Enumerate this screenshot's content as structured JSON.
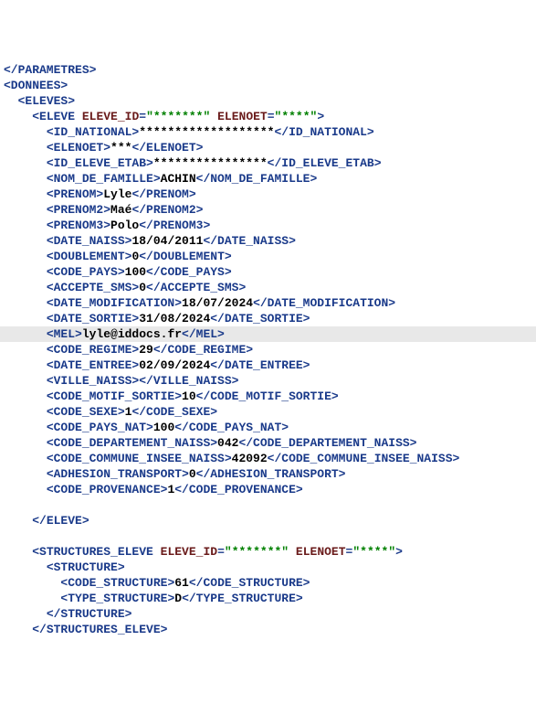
{
  "lines": [
    {
      "indent": 0,
      "type": "close",
      "tag": "PARAMETRES"
    },
    {
      "indent": 0,
      "type": "open",
      "tag": "DONNEES"
    },
    {
      "indent": 1,
      "type": "open",
      "tag": "ELEVES"
    },
    {
      "indent": 2,
      "type": "open-attrs",
      "tag": "ELEVE",
      "attrs": [
        {
          "name": "ELEVE_ID",
          "val": "*******"
        },
        {
          "name": "ELENOET",
          "val": "****"
        }
      ]
    },
    {
      "indent": 3,
      "type": "leaf",
      "tag": "ID_NATIONAL",
      "val": "*******************"
    },
    {
      "indent": 3,
      "type": "leaf",
      "tag": "ELENOET",
      "val": "***"
    },
    {
      "indent": 3,
      "type": "leaf",
      "tag": "ID_ELEVE_ETAB",
      "val": "****************"
    },
    {
      "indent": 3,
      "type": "leaf",
      "tag": "NOM_DE_FAMILLE",
      "val": "ACHIN"
    },
    {
      "indent": 3,
      "type": "leaf",
      "tag": "PRENOM",
      "val": "Lyle"
    },
    {
      "indent": 3,
      "type": "leaf",
      "tag": "PRENOM2",
      "val": "Maé"
    },
    {
      "indent": 3,
      "type": "leaf",
      "tag": "PRENOM3",
      "val": "Polo"
    },
    {
      "indent": 3,
      "type": "leaf",
      "tag": "DATE_NAISS",
      "val": "18/04/2011"
    },
    {
      "indent": 3,
      "type": "leaf",
      "tag": "DOUBLEMENT",
      "val": "0"
    },
    {
      "indent": 3,
      "type": "leaf",
      "tag": "CODE_PAYS",
      "val": "100"
    },
    {
      "indent": 3,
      "type": "leaf",
      "tag": "ACCEPTE_SMS",
      "val": "0"
    },
    {
      "indent": 3,
      "type": "leaf",
      "tag": "DATE_MODIFICATION",
      "val": "18/07/2024"
    },
    {
      "indent": 3,
      "type": "leaf",
      "tag": "DATE_SORTIE",
      "val": "31/08/2024"
    },
    {
      "indent": 3,
      "type": "leaf",
      "tag": "MEL",
      "val": "lyle@iddocs.fr",
      "hl": true
    },
    {
      "indent": 3,
      "type": "leaf",
      "tag": "CODE_REGIME",
      "val": "29"
    },
    {
      "indent": 3,
      "type": "leaf",
      "tag": "DATE_ENTREE",
      "val": "02/09/2024"
    },
    {
      "indent": 3,
      "type": "leaf",
      "tag": "VILLE_NAISS",
      "val": ""
    },
    {
      "indent": 3,
      "type": "leaf",
      "tag": "CODE_MOTIF_SORTIE",
      "val": "10"
    },
    {
      "indent": 3,
      "type": "leaf",
      "tag": "CODE_SEXE",
      "val": "1"
    },
    {
      "indent": 3,
      "type": "leaf",
      "tag": "CODE_PAYS_NAT",
      "val": "100"
    },
    {
      "indent": 3,
      "type": "leaf",
      "tag": "CODE_DEPARTEMENT_NAISS",
      "val": "042"
    },
    {
      "indent": 3,
      "type": "leaf",
      "tag": "CODE_COMMUNE_INSEE_NAISS",
      "val": "42092"
    },
    {
      "indent": 3,
      "type": "leaf",
      "tag": "ADHESION_TRANSPORT",
      "val": "0"
    },
    {
      "indent": 3,
      "type": "leaf",
      "tag": "CODE_PROVENANCE",
      "val": "1"
    },
    {
      "type": "blank"
    },
    {
      "indent": 2,
      "type": "close",
      "tag": "ELEVE"
    },
    {
      "type": "blank"
    },
    {
      "indent": 2,
      "type": "open-attrs",
      "tag": "STRUCTURES_ELEVE",
      "attrs": [
        {
          "name": "ELEVE_ID",
          "val": "*******"
        },
        {
          "name": "ELENOET",
          "val": "****"
        }
      ]
    },
    {
      "indent": 3,
      "type": "open",
      "tag": "STRUCTURE"
    },
    {
      "indent": 4,
      "type": "leaf",
      "tag": "CODE_STRUCTURE",
      "val": "61"
    },
    {
      "indent": 4,
      "type": "leaf",
      "tag": "TYPE_STRUCTURE",
      "val": "D"
    },
    {
      "indent": 3,
      "type": "close",
      "tag": "STRUCTURE"
    },
    {
      "indent": 2,
      "type": "close",
      "tag": "STRUCTURES_ELEVE"
    }
  ]
}
